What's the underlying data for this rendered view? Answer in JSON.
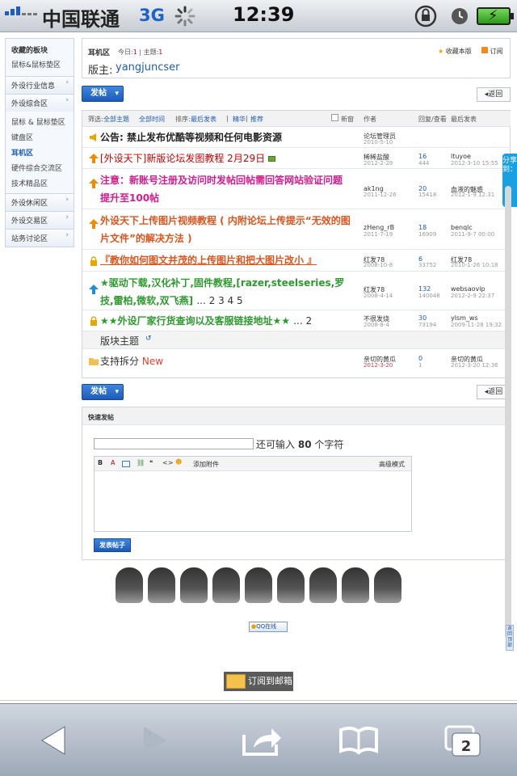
{
  "status": {
    "carrier": "中国联通",
    "network": "3G",
    "time": "12:39"
  },
  "sidebar": {
    "title": "收藏的板块",
    "fav": "鼠标&鼠标垫区",
    "sections": [
      {
        "label": "外设行业信息"
      },
      {
        "label": "外设综合区",
        "items": [
          "鼠标 & 鼠标垫区",
          "键盘区",
          "耳机区",
          "硬件综合交流区",
          "技术精品区"
        ]
      },
      {
        "label": "外设休闲区"
      },
      {
        "label": "外设交易区"
      },
      {
        "label": "站务讨论区"
      }
    ]
  },
  "forum": {
    "name": "耳机区",
    "today_label": "今日:",
    "today": "1",
    "topics_label": "主题:",
    "topics": "1",
    "bookmark": "收藏本版",
    "rss": "订阅",
    "moderator_label": "版主:",
    "moderator": "yangjuncser"
  },
  "buttons": {
    "post": "发帖",
    "back": "返回",
    "submit": "发表帖子"
  },
  "filter": {
    "label": "筛选:",
    "all_topics": "全部主题",
    "all_time": "全部时间",
    "sort": "排序:",
    "latest": "最后发表",
    "digest": "精华",
    "recommend": "推荐",
    "new_window": "新窗"
  },
  "columns": {
    "author": "作者",
    "replies": "回复/查看",
    "last": "最后发表"
  },
  "threads": [
    {
      "title": "公告: 禁止发布优酷等视频和任何电影资源",
      "author": "论坛管理员",
      "date": "2010-5-10",
      "replies": "",
      "views": "",
      "last_user": "",
      "last_date": "",
      "color": "#222"
    },
    {
      "title": "[外设天下]新版论坛发图教程 2月29日",
      "author": "稀稀盐酸",
      "date": "2012-2-29",
      "replies": "16",
      "views": "444",
      "last_user": "ltuyoe",
      "last_date": "2012-3-10 15:55",
      "color": "#d10000"
    },
    {
      "title": "注意：新账号注册及访问时发帖回帖需回答网站验证问题提升至100帖",
      "author": "ak1ng",
      "date": "2011-12-26",
      "replies": "20",
      "views": "15418",
      "last_user": "血液的魅惑",
      "last_date": "2012-1-9 12:31",
      "color": "#d61b8c"
    },
    {
      "title": "外设天下上传图片视频教程 ( 内附论坛上传提示“无效的图片文件”的解决方法 )",
      "author": "zHeng_rB",
      "date": "2011-7-19",
      "replies": "18",
      "views": "16909",
      "last_user": "benqlc",
      "last_date": "2011-9-7 00:00",
      "color": "#e0531b"
    },
    {
      "title": "『教你如何图文并茂的上传图片和把大图片改小 』",
      "author": "红发78",
      "date": "2008-10-8",
      "replies": "6",
      "views": "33752",
      "last_user": "红发78",
      "last_date": "2010-1-26 10:18",
      "color": "#e0531b"
    },
    {
      "title": "★驱动下载,汉化补丁,固件教程,[razer,steelseries,罗技,雷柏,微软,双飞燕]",
      "suffix": "... 2 3 4 5",
      "author": "红发78",
      "date": "2008-4-14",
      "replies": "132",
      "views": "140048",
      "last_user": "websaovip",
      "last_date": "2012-2-9 22:37",
      "color": "#2d9a2d"
    },
    {
      "title": "★★外设厂家行货查询以及客服链接地址★★",
      "suffix": "... 2",
      "author": "不很发烧",
      "date": "2008-8-4",
      "replies": "30",
      "views": "73194",
      "last_user": "ylsm_ws",
      "last_date": "2009-11-28 19:32",
      "color": "#2d9a2d"
    }
  ],
  "section_title": "版块主题",
  "forum_thread": {
    "title": "支持拆分",
    "new": "New",
    "author": "亲切的黄瓜",
    "date": "2012-3-20",
    "replies": "0",
    "views": "1",
    "last_user": "亲切的黄瓜",
    "last_date": "2012-3-20 12:36"
  },
  "quick": {
    "title": "快速发帖",
    "hint_pre": "还可输入",
    "count": "80",
    "hint_post": "个字符",
    "attach": "添加附件",
    "advanced": "高级模式"
  },
  "qq": "QQ在线",
  "subscribe": "订阅到邮箱",
  "share": "分享到：",
  "top": "返回顶部"
}
